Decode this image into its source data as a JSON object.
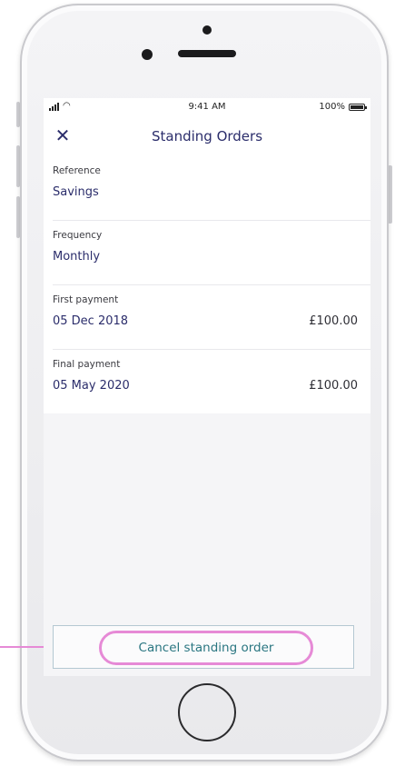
{
  "status_bar": {
    "time": "9:41 AM",
    "battery": "100%",
    "icons": [
      "signal-icon",
      "wifi-icon",
      "battery-icon"
    ]
  },
  "header": {
    "title": "Standing Orders",
    "close_icon": "close-icon"
  },
  "details": [
    {
      "label": "Reference",
      "value": "Savings",
      "amount": ""
    },
    {
      "label": "Frequency",
      "value": "Monthly",
      "amount": ""
    },
    {
      "label": "First payment",
      "value": "05 Dec 2018",
      "amount": "£100.00"
    },
    {
      "label": "Final payment",
      "value": "05 May 2020",
      "amount": "£100.00"
    }
  ],
  "actions": {
    "cancel_label": "Cancel standing order"
  },
  "colors": {
    "title": "#2b2d6b",
    "value": "#2b2d6b",
    "cancel_text": "#2a7681",
    "highlight": "#e68ad6",
    "background": "#f5f5f7"
  }
}
